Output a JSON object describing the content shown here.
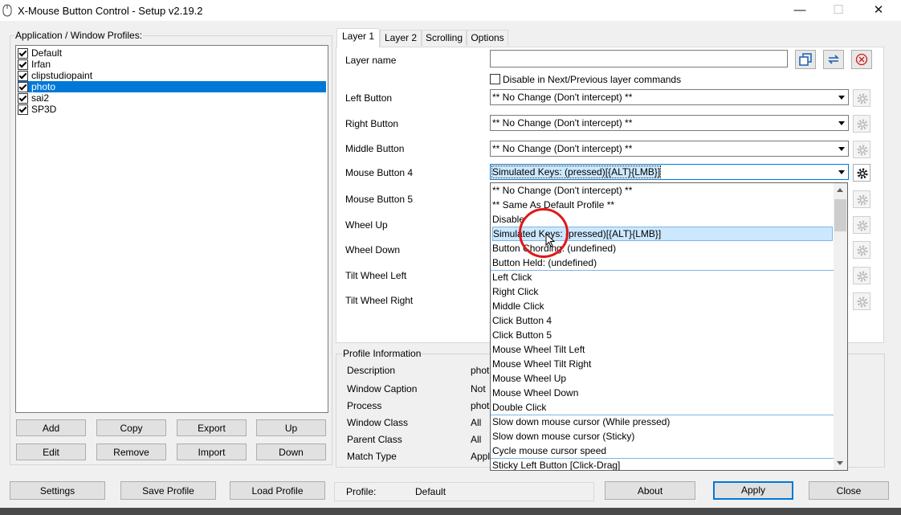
{
  "window": {
    "title": "X-Mouse Button Control - Setup v2.19.2",
    "minimize": "—",
    "maximize": "☐",
    "close": "✕"
  },
  "profiles": {
    "label": "Application / Window Profiles:",
    "items": [
      {
        "name": "Default",
        "checked": true,
        "selected": false
      },
      {
        "name": "Irfan",
        "checked": true,
        "selected": false
      },
      {
        "name": "clipstudiopaint",
        "checked": true,
        "selected": false
      },
      {
        "name": "photo",
        "checked": true,
        "selected": true
      },
      {
        "name": "sai2",
        "checked": true,
        "selected": false
      },
      {
        "name": "SP3D",
        "checked": true,
        "selected": false
      }
    ],
    "buttons": {
      "add": "Add",
      "copy": "Copy",
      "export": "Export",
      "up": "Up",
      "edit": "Edit",
      "remove": "Remove",
      "import": "Import",
      "down": "Down"
    }
  },
  "tabs": [
    "Layer 1",
    "Layer 2",
    "Scrolling",
    "Options"
  ],
  "layer": {
    "name_label": "Layer name",
    "name_value": "",
    "disable_label": "Disable in Next/Previous layer commands",
    "rows": [
      {
        "label": "Left Button",
        "value": "** No Change (Don't intercept) **"
      },
      {
        "label": "Right Button",
        "value": "** No Change (Don't intercept) **"
      },
      {
        "label": "Middle Button",
        "value": "** No Change (Don't intercept) **"
      },
      {
        "label": "Mouse Button 4",
        "value": "Simulated Keys: (pressed)[{ALT}{LMB}]"
      },
      {
        "label": "Mouse Button 5",
        "value": ""
      },
      {
        "label": "Wheel Up",
        "value": ""
      },
      {
        "label": "Wheel Down",
        "value": ""
      },
      {
        "label": "Tilt Wheel Left",
        "value": ""
      },
      {
        "label": "Tilt Wheel Right",
        "value": ""
      }
    ]
  },
  "dropdown": {
    "items": [
      "** No Change (Don't intercept) **",
      "** Same As Default Profile **",
      "Disable",
      "Simulated Keys: (pressed)[{ALT}{LMB}]",
      "Button Chording: (undefined)",
      "Button Held: (undefined)",
      "Left Click",
      "Right Click",
      "Middle Click",
      "Click Button 4",
      "Click Button 5",
      "Mouse Wheel Tilt Left",
      "Mouse Wheel Tilt Right",
      "Mouse Wheel Up",
      "Mouse Wheel Down",
      "Double Click",
      "Slow down mouse cursor (While pressed)",
      "Slow down mouse cursor (Sticky)",
      "Cycle mouse cursor speed",
      "Sticky Left Button [Click-Drag]"
    ],
    "highlighted_index": 3
  },
  "profile_info": {
    "title": "Profile Information",
    "rows": [
      {
        "label": "Description",
        "value": "phot"
      },
      {
        "label": "Window Caption",
        "value": "Not"
      },
      {
        "label": "Process",
        "value": "phot"
      },
      {
        "label": "Window Class",
        "value": "All"
      },
      {
        "label": "Parent Class",
        "value": "All"
      },
      {
        "label": "Match Type",
        "value": "Appl"
      }
    ]
  },
  "footer": {
    "settings": "Settings",
    "save_profile": "Save Profile",
    "load_profile": "Load Profile",
    "profile_label": "Profile:",
    "profile_value": "Default",
    "about": "About",
    "apply": "Apply",
    "close": "Close"
  }
}
